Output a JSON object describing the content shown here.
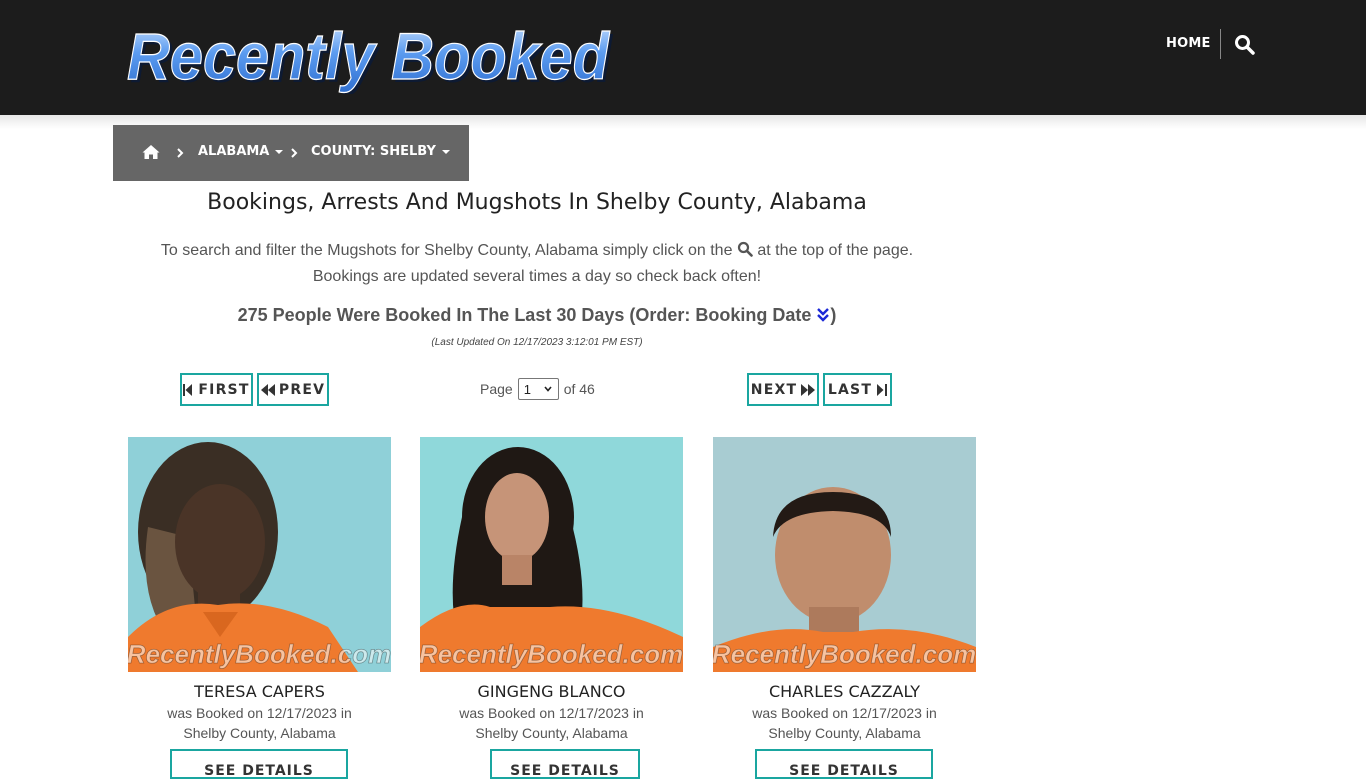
{
  "header": {
    "logo_text": "Recently Booked",
    "nav_home": "HOME",
    "search_icon": "search-icon"
  },
  "breadcrumb": {
    "home_icon": "home-icon",
    "state": "ALABAMA",
    "county": "COUNTY: SHELBY"
  },
  "main": {
    "title": "Bookings, Arrests And Mugshots In Shelby County, Alabama",
    "intro_part1": "To search and filter the Mugshots for Shelby County, Alabama simply click on the",
    "intro_part2": "at the top of the page.",
    "intro_line2": "Bookings are updated several times a day so check back often!",
    "count_text": "275 People Were Booked In The Last 30 Days (Order: Booking Date",
    "count_close": ")",
    "updated": "(Last Updated On 12/17/2023 3:12:01 PM EST)"
  },
  "pager": {
    "first": "FIRST",
    "prev": "PREV",
    "next": "NEXT",
    "last": "LAST",
    "page_label": "Page",
    "current_page": "1",
    "of_label": "of 46"
  },
  "watermark": "RecentlyBooked.com",
  "people": [
    {
      "name": "TERESA CAPERS",
      "booked_line": "was Booked on 12/17/2023 in",
      "location": "Shelby County, Alabama",
      "button": "SEE DETAILS"
    },
    {
      "name": "GINGENG BLANCO",
      "booked_line": "was Booked on 12/17/2023 in",
      "location": "Shelby County, Alabama",
      "button": "SEE DETAILS"
    },
    {
      "name": "CHARLES CAZZALY",
      "booked_line": "was Booked on 12/17/2023 in",
      "location": "Shelby County, Alabama",
      "button": "SEE DETAILS"
    }
  ],
  "colors": {
    "header_bg": "#1c1c1c",
    "breadcrumb_bg": "#666666",
    "accent_teal": "#1aa6a0",
    "logo_blue": "#4a8ee8",
    "sort_icon": "#1b28d6"
  }
}
